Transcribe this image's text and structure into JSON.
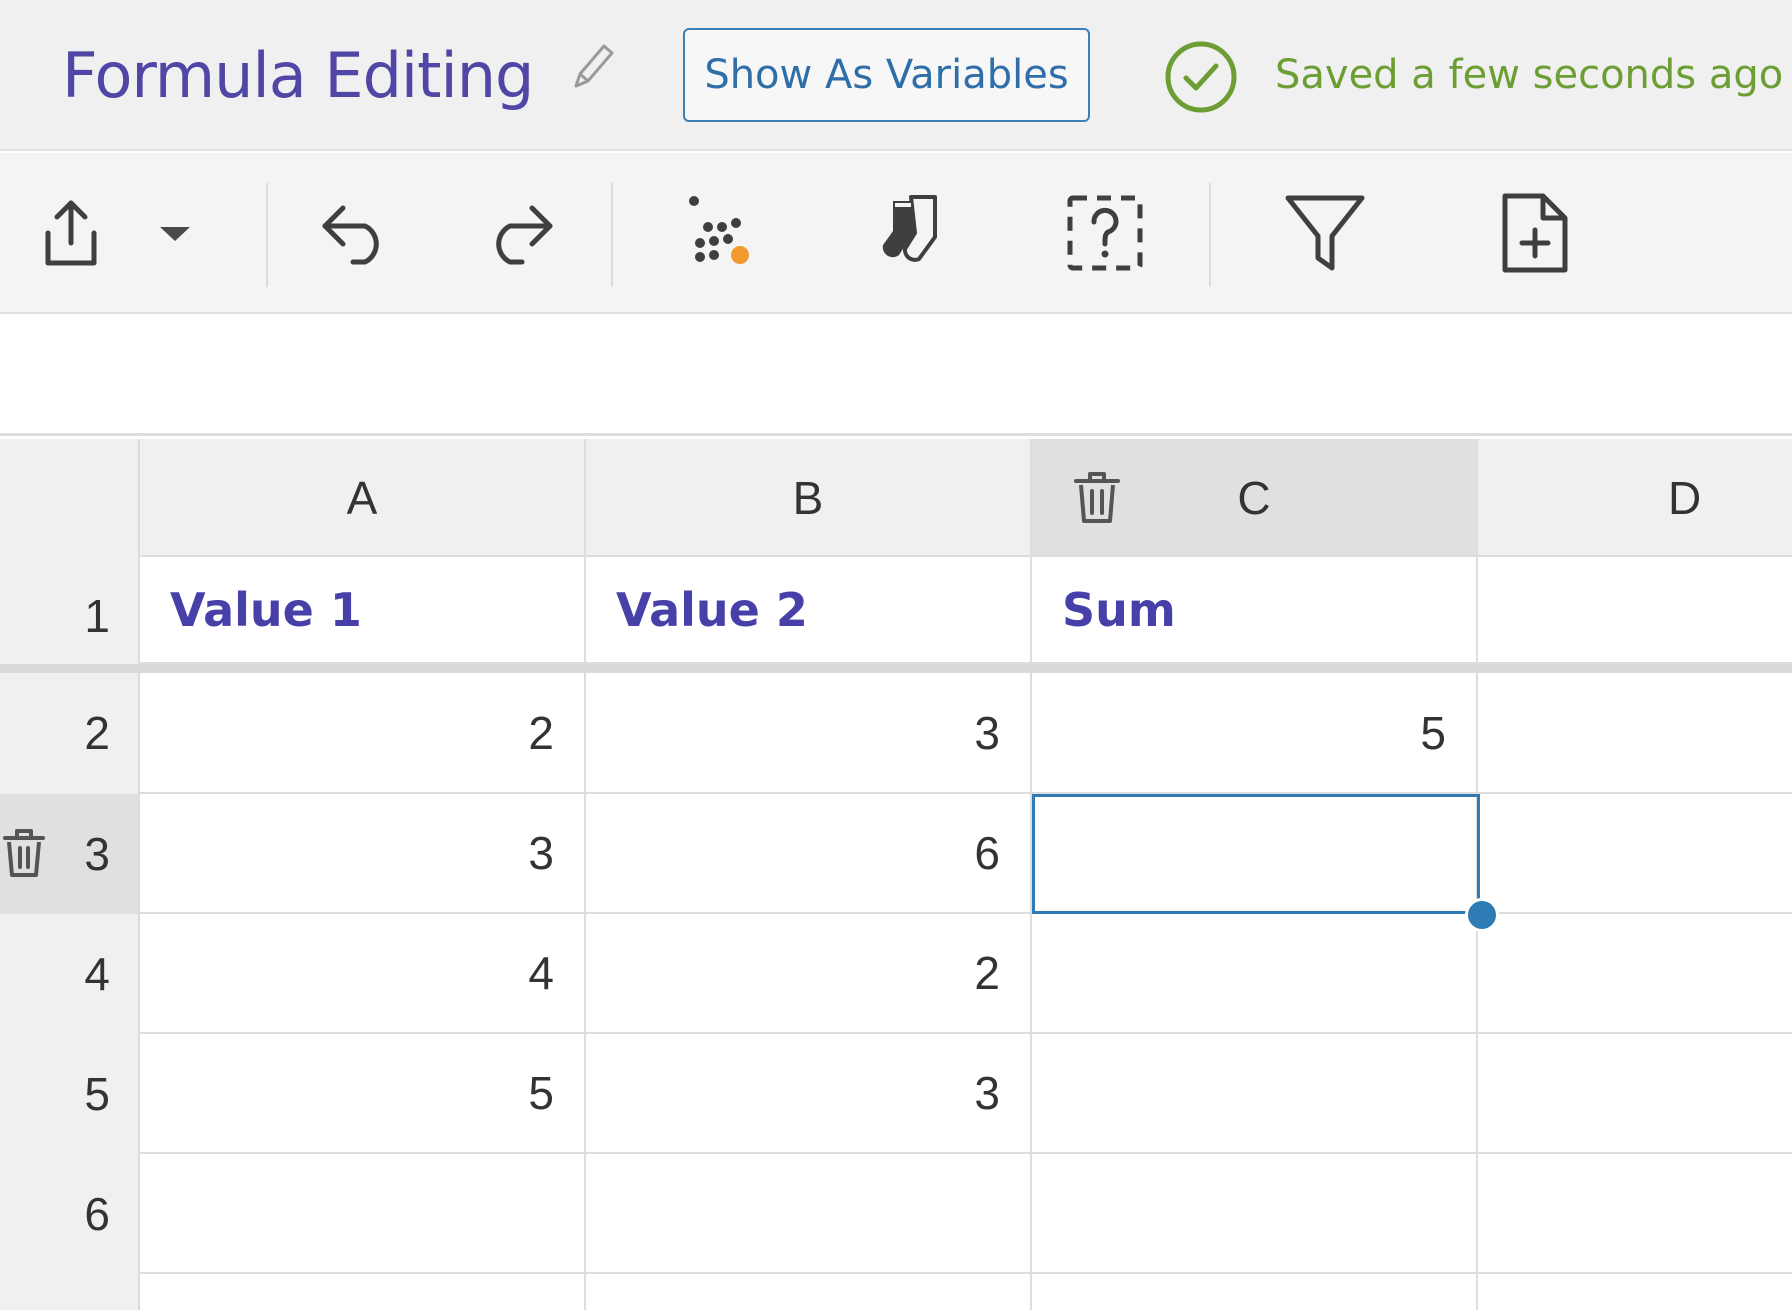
{
  "header": {
    "title": "Formula Editing",
    "show_vars_label": "Show As Variables",
    "saved_status": "Saved a few seconds ago",
    "saved_color": "#6c9e34",
    "title_color": "#4f46a5"
  },
  "toolbar": {
    "items": [
      {
        "name": "export-icon"
      },
      {
        "name": "export-dropdown-caret-icon"
      },
      {
        "name": "undo-icon"
      },
      {
        "name": "redo-icon"
      },
      {
        "name": "scatter-dots-icon"
      },
      {
        "name": "socks-icon"
      },
      {
        "name": "question-box-icon"
      },
      {
        "name": "filter-icon"
      },
      {
        "name": "new-file-icon"
      }
    ]
  },
  "grid": {
    "columns": [
      "A",
      "B",
      "C",
      "D"
    ],
    "rows": [
      "1",
      "2",
      "3",
      "4",
      "5",
      "6"
    ],
    "header_row": [
      "Value 1",
      "Value 2",
      "Sum",
      ""
    ],
    "data": [
      [
        "2",
        "3",
        "5",
        ""
      ],
      [
        "3",
        "6",
        "",
        ""
      ],
      [
        "4",
        "2",
        "",
        ""
      ],
      [
        "5",
        "3",
        "",
        ""
      ],
      [
        "",
        "",
        "",
        ""
      ]
    ],
    "selected_cell": "C3",
    "selection_color": "#2f7bb5"
  }
}
